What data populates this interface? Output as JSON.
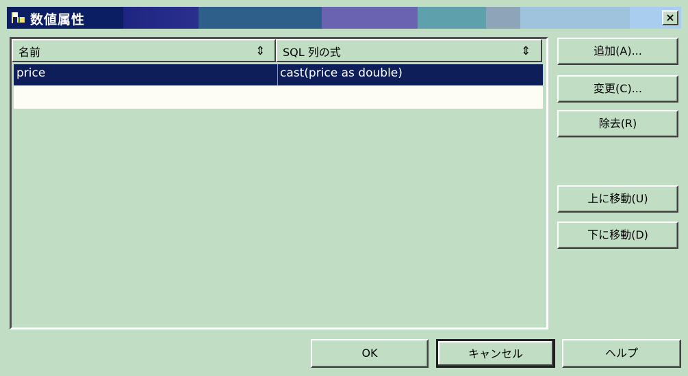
{
  "window": {
    "title": "数値属性",
    "close_label": "×"
  },
  "list": {
    "columns": [
      {
        "label": "名前",
        "sort_icon": "⇕"
      },
      {
        "label": "SQL 列の式",
        "sort_icon": "⇕"
      }
    ],
    "rows": [
      {
        "name": "price",
        "expression": "cast(price as double)",
        "selected": true
      }
    ]
  },
  "side_buttons": {
    "add": "追加(A)...",
    "change": "変更(C)...",
    "remove": "除去(R)",
    "move_up": "上に移動(U)",
    "move_down": "下に移動(D)"
  },
  "bottom_buttons": {
    "ok": "OK",
    "cancel": "キャンセル",
    "help": "ヘルプ"
  },
  "colors": {
    "background": "#c1ddc4",
    "selection": "#0e1e58",
    "title_dark": "#0b1d63"
  },
  "icons": {
    "window": "flag-window-icon",
    "sort": "sort-updown-icon"
  }
}
